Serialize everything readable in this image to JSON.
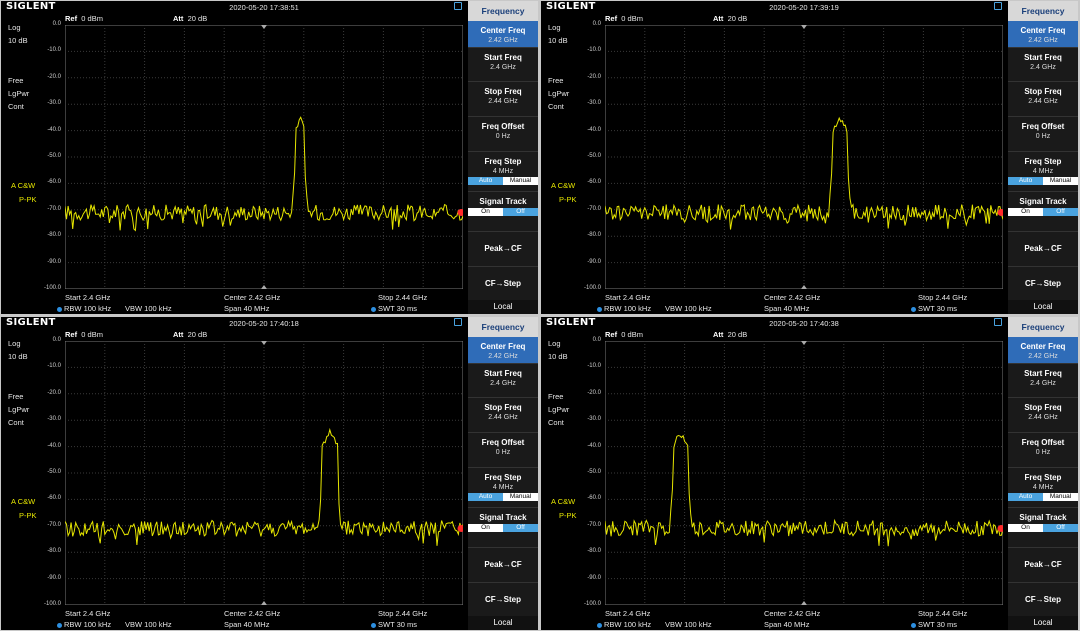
{
  "screens": [
    {
      "brand": "SIGLENT",
      "timestamp": "2020-05-20 17:38:51",
      "ref_label": "Ref",
      "ref_value": "0 dBm",
      "att_label": "Att",
      "att_value": "20 dB",
      "scale_type": "Log",
      "scale_div": "10 dB",
      "mode1": "Free",
      "mode2": "LgPwr",
      "mode3": "Cont",
      "trace_label": "A  C&W",
      "detector": "P-PK",
      "start": "Start  2.4 GHz",
      "center": "Center  2.42 GHz",
      "stop": "Stop  2.44 GHz",
      "rbw": "RBW  100 kHz",
      "vbw": "VBW  100 kHz",
      "span": "Span    40 MHz",
      "swt": "SWT  30 ms",
      "peak_x": 0.59
    },
    {
      "brand": "SIGLENT",
      "timestamp": "2020-05-20 17:39:19",
      "ref_label": "Ref",
      "ref_value": "0 dBm",
      "att_label": "Att",
      "att_value": "20 dB",
      "scale_type": "Log",
      "scale_div": "10 dB",
      "mode1": "Free",
      "mode2": "LgPwr",
      "mode3": "Cont",
      "trace_label": "A  C&W",
      "detector": "P-PK",
      "start": "Start  2.4 GHz",
      "center": "Center  2.42 GHz",
      "stop": "Stop  2.44 GHz",
      "rbw": "RBW  100 kHz",
      "vbw": "VBW  100 kHz",
      "span": "Span    40 MHz",
      "swt": "SWT  30 ms",
      "peak_x": 0.59
    },
    {
      "brand": "SIGLENT",
      "timestamp": "2020-05-20 17:40:18",
      "ref_label": "Ref",
      "ref_value": "0 dBm",
      "att_label": "Att",
      "att_value": "20 dB",
      "scale_type": "Log",
      "scale_div": "10 dB",
      "mode1": "Free",
      "mode2": "LgPwr",
      "mode3": "Cont",
      "trace_label": "A  C&W",
      "detector": "P-PK",
      "start": "Start  2.4 GHz",
      "center": "Center  2.42 GHz",
      "stop": "Stop  2.44 GHz",
      "rbw": "RBW  100 kHz",
      "vbw": "VBW  100 kHz",
      "span": "Span    40 MHz",
      "swt": "SWT  30 ms",
      "peak_x": 0.665
    },
    {
      "brand": "SIGLENT",
      "timestamp": "2020-05-20 17:40:38",
      "ref_label": "Ref",
      "ref_value": "0 dBm",
      "att_label": "Att",
      "att_value": "20 dB",
      "scale_type": "Log",
      "scale_div": "10 dB",
      "mode1": "Free",
      "mode2": "LgPwr",
      "mode3": "Cont",
      "trace_label": "A  C&W",
      "detector": "P-PK",
      "start": "Start  2.4 GHz",
      "center": "Center  2.42 GHz",
      "stop": "Stop  2.44 GHz",
      "rbw": "RBW  100 kHz",
      "vbw": "VBW  100 kHz",
      "span": "Span    40 MHz",
      "swt": "SWT  30 ms",
      "peak_x": 0.19
    }
  ],
  "y_ticks": [
    "0.0",
    "-10.0",
    "-20.0",
    "-30.0",
    "-40.0",
    "-50.0",
    "-60.0",
    "-70.0",
    "-80.0",
    "-90.0",
    "-100.0"
  ],
  "menu": {
    "title": "Frequency",
    "center_freq_label": "Center Freq",
    "center_freq_value": "2.42 GHz",
    "start_freq_label": "Start Freq",
    "start_freq_value": "2.4 GHz",
    "stop_freq_label": "Stop Freq",
    "stop_freq_value": "2.44 GHz",
    "freq_offset_label": "Freq Offset",
    "freq_offset_value": "0 Hz",
    "freq_step_label": "Freq Step",
    "freq_step_value": "4 MHz",
    "auto": "Auto",
    "manual": "Manual",
    "signal_track_label": "Signal Track",
    "on": "On",
    "off": "Off",
    "peak_cf": "Peak→CF",
    "cf_step": "CF→Step",
    "footer": "Local"
  },
  "colors": {
    "trace": "#e6e600",
    "grid": "#3a3a3a",
    "accent": "#2f6cb8",
    "marker": "#ff2a2a"
  }
}
